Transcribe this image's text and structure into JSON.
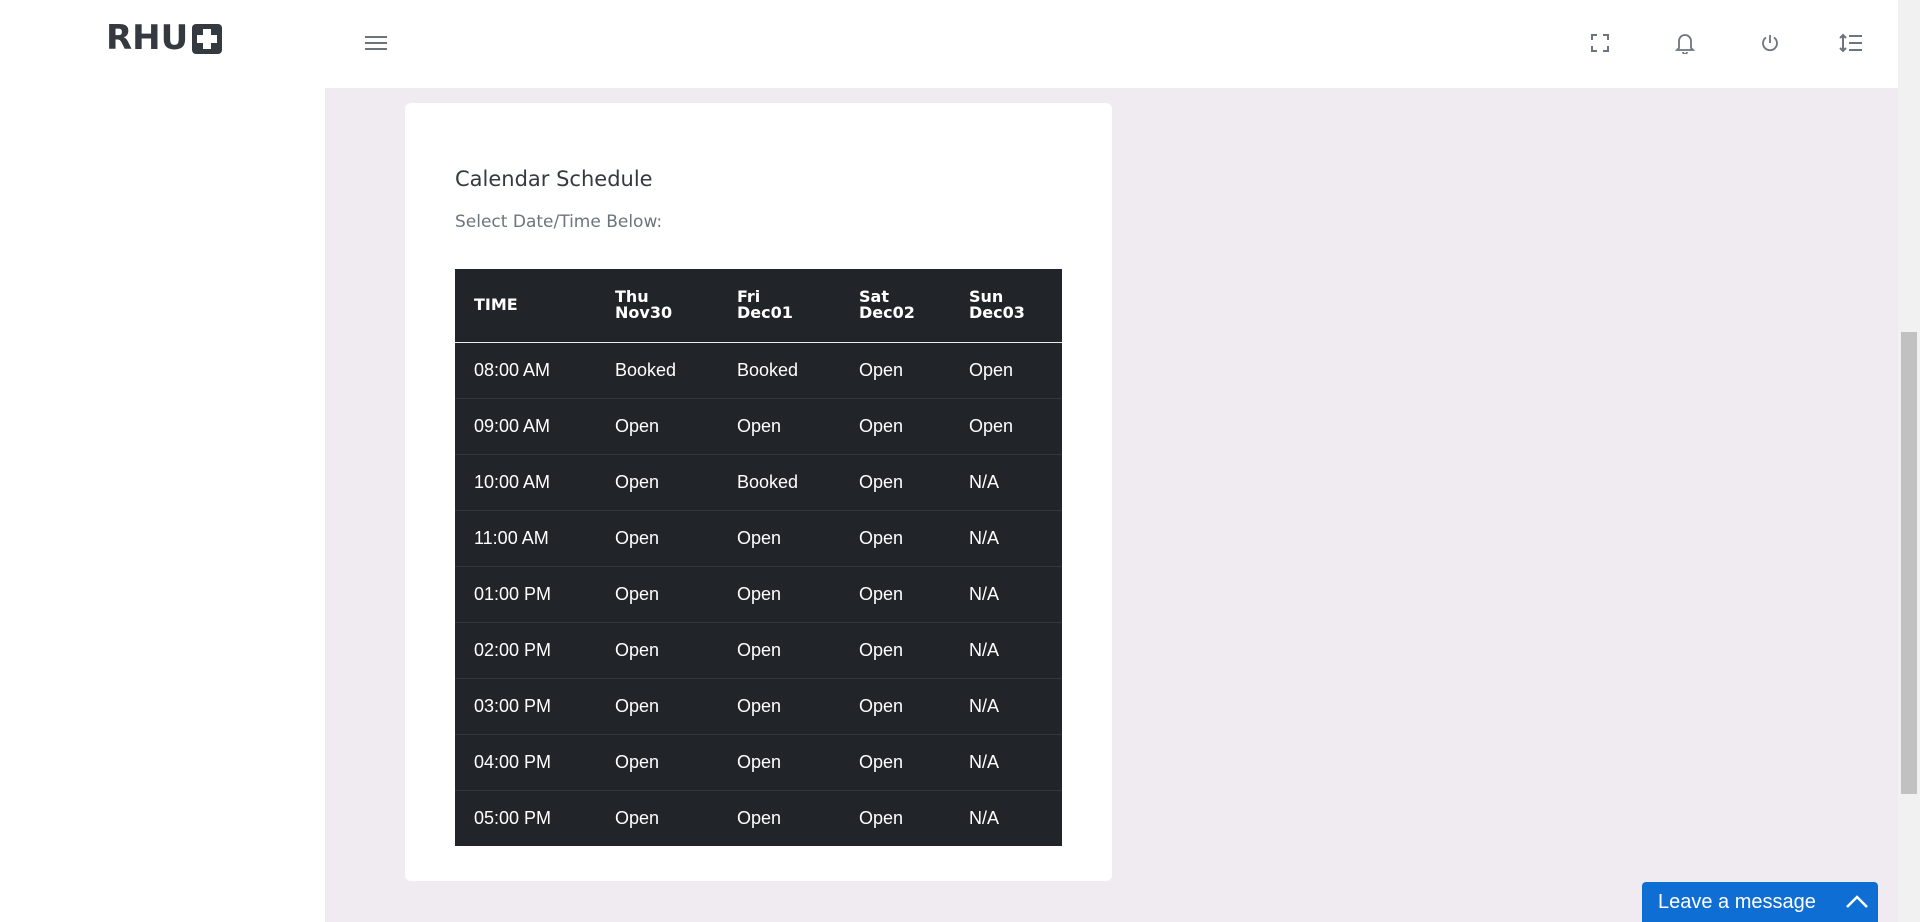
{
  "brand": {
    "logo_text": "RHU"
  },
  "topbar": {
    "icons": [
      "menu-icon",
      "fullscreen-icon",
      "bell-icon",
      "power-icon",
      "line-height-icon"
    ]
  },
  "card": {
    "title": "Calendar Schedule",
    "subtitle": "Select Date/Time Below:"
  },
  "schedule": {
    "headers": [
      {
        "line1": "TIME",
        "line2": ""
      },
      {
        "line1": "Thu",
        "line2": "Nov30"
      },
      {
        "line1": "Fri",
        "line2": "Dec01"
      },
      {
        "line1": "Sat",
        "line2": "Dec02"
      },
      {
        "line1": "Sun",
        "line2": "Dec03"
      }
    ],
    "rows": [
      [
        "08:00 AM",
        "Booked",
        "Booked",
        "Open",
        "Open"
      ],
      [
        "09:00 AM",
        "Open",
        "Open",
        "Open",
        "Open"
      ],
      [
        "10:00 AM",
        "Open",
        "Booked",
        "Open",
        "N/A"
      ],
      [
        "11:00 AM",
        "Open",
        "Open",
        "Open",
        "N/A"
      ],
      [
        "01:00 PM",
        "Open",
        "Open",
        "Open",
        "N/A"
      ],
      [
        "02:00 PM",
        "Open",
        "Open",
        "Open",
        "N/A"
      ],
      [
        "03:00 PM",
        "Open",
        "Open",
        "Open",
        "N/A"
      ],
      [
        "04:00 PM",
        "Open",
        "Open",
        "Open",
        "N/A"
      ],
      [
        "05:00 PM",
        "Open",
        "Open",
        "Open",
        "N/A"
      ]
    ]
  },
  "chat_widget": {
    "label": "Leave a message"
  },
  "colors": {
    "content_bg": "#f0ebf1",
    "table_bg": "#212529",
    "widget_bg": "#0f6ed4",
    "logo": "#343a40"
  }
}
